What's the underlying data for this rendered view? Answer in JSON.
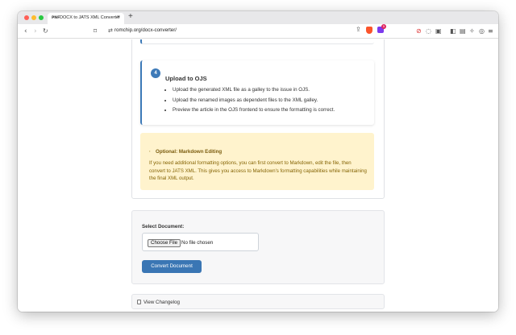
{
  "browser": {
    "tab": {
      "favicon_text": "PNF",
      "title": "DOCX to JATS XML Converter",
      "close": "×"
    },
    "new_tab": "+",
    "url": "romchip.org/docx-converter/",
    "rewards_badge": "5"
  },
  "step4": {
    "number": "4",
    "title": "Upload to OJS",
    "items": [
      "Upload the generated XML file as a galley to the issue in OJS.",
      "Upload the renamed images as dependent files to the XML galley.",
      "Preview the article in the OJS frontend to ensure the formatting is correct."
    ]
  },
  "optional": {
    "icon": ",",
    "title": "Optional: Markdown Editing",
    "body": "If you need additional formatting options, you can first convert to Markdown, edit the file, then convert to JATS XML. This gives you access to Markdown's formatting capabilities while maintaining the final XML output."
  },
  "upload": {
    "label": "Select Document:",
    "choose_button": "Choose File",
    "no_file": "No file chosen",
    "convert_button": "Convert Document"
  },
  "changelog": {
    "label": "View Changelog"
  },
  "colors": {
    "accent": "#3d7ab8",
    "button": "#3a76b4",
    "warning_bg": "#fff3cd",
    "warning_text": "#856404"
  }
}
